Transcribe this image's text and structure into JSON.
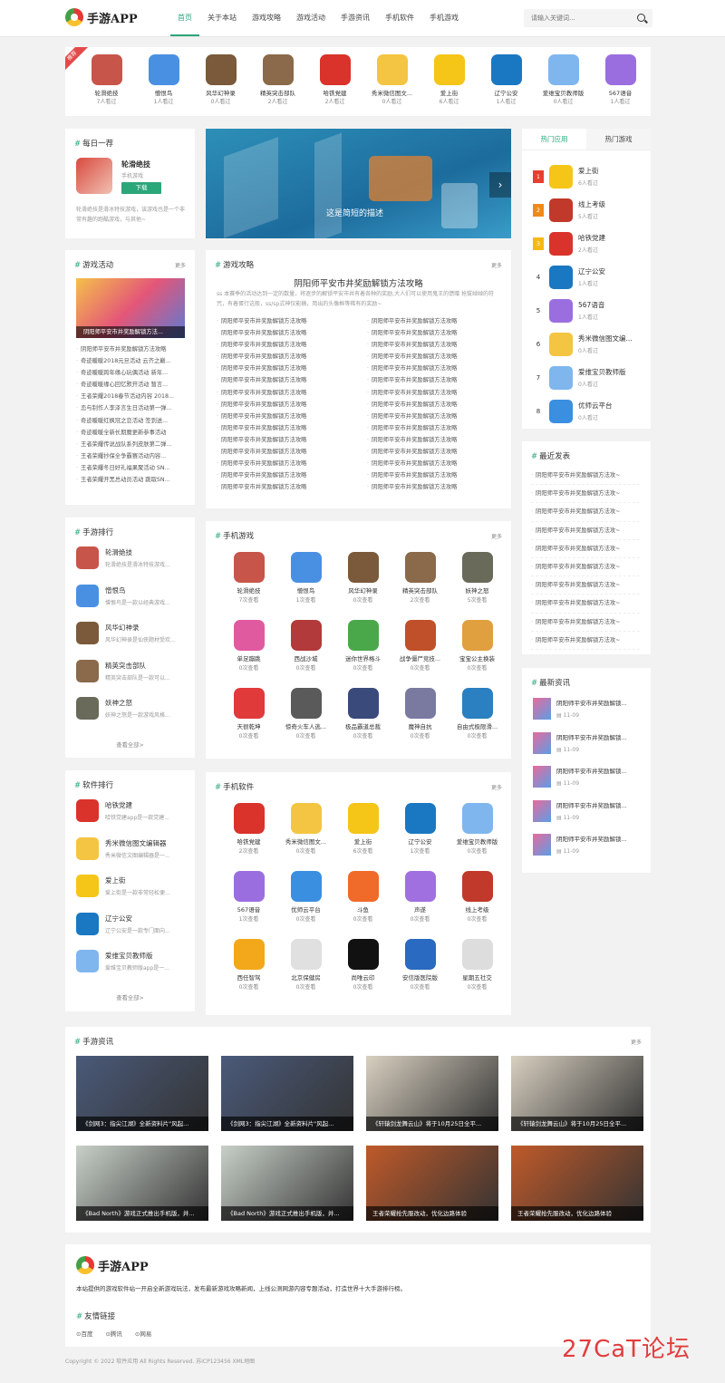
{
  "header": {
    "logo_text": "手游APP",
    "nav": [
      "首页",
      "关于本站",
      "游戏攻略",
      "游戏活动",
      "手游资讯",
      "手机软件",
      "手机游戏"
    ],
    "search_placeholder": "请输入关键词..."
  },
  "top_strip": {
    "hot_tag": "推荐",
    "items": [
      {
        "name": "轮滑绝技",
        "meta": "7人看过",
        "color": "#c8554a"
      },
      {
        "name": "憎恨鸟",
        "meta": "1人看过",
        "color": "#4a90e2"
      },
      {
        "name": "风华幻神录",
        "meta": "0人看过",
        "color": "#7a5a3a"
      },
      {
        "name": "精英突击部队",
        "meta": "2人看过",
        "color": "#8a6a4a"
      },
      {
        "name": "哈铁党建",
        "meta": "2人看过",
        "color": "#d9332b"
      },
      {
        "name": "秀米微信图文...",
        "meta": "0人看过",
        "color": "#f4c542"
      },
      {
        "name": "爱上街",
        "meta": "6人看过",
        "color": "#f5c518"
      },
      {
        "name": "辽宁公安",
        "meta": "1人看过",
        "color": "#1a78c2"
      },
      {
        "name": "爱维宝贝教师版",
        "meta": "0人看过",
        "color": "#7fb6ee"
      },
      {
        "name": "567语音",
        "meta": "1人看过",
        "color": "#9b6ee0"
      }
    ]
  },
  "daily": {
    "title": "每日一荐",
    "app_name": "轮滑绝技",
    "app_type": "手机游戏",
    "download": "下载",
    "desc": "轮滑绝技是滑冰特技游戏，该游戏也是一个非常有趣的跑酷游戏，与其他~"
  },
  "banner": {
    "caption": "这是简短的描述"
  },
  "rank_tabs": {
    "tab1": "热门应用",
    "tab2": "热门游戏"
  },
  "rank_list": [
    {
      "no": "1",
      "name": "爱上街",
      "meta": "6人看过",
      "color": "#f5c518"
    },
    {
      "no": "2",
      "name": "线上考级",
      "meta": "5人看过",
      "color": "#c0392b"
    },
    {
      "no": "3",
      "name": "哈铁党建",
      "meta": "2人看过",
      "color": "#d9332b"
    },
    {
      "no": "4",
      "name": "辽宁公安",
      "meta": "1人看过",
      "color": "#1a78c2"
    },
    {
      "no": "5",
      "name": "567语音",
      "meta": "1人看过",
      "color": "#9b6ee0"
    },
    {
      "no": "6",
      "name": "秀米微信图文编...",
      "meta": "0人看过",
      "color": "#f4c542"
    },
    {
      "no": "7",
      "name": "爱维宝贝教师版",
      "meta": "0人看过",
      "color": "#7fb6ee"
    },
    {
      "no": "8",
      "name": "优师云平台",
      "meta": "0人看过",
      "color": "#3a8fe0"
    }
  ],
  "activities": {
    "title": "游戏活动",
    "more": "更多",
    "img_caption": "阴阳师平安市井奖励解锁方法...",
    "items": [
      "阴阳师平安市井奖励解锁方法攻略",
      "奇迹暖暖2018元旦活动 云齐之巅...",
      "奇迹暖暖跨年缘心玩偶活动 新年...",
      "奇迹暖暖缘心回忆默开活动 暂言...",
      "王者荣耀2018春节活动内容 2018...",
      "恋与制作人李泽言生日活动第一弹...",
      "奇迹暖暖红枫冠之恋活动 签到送...",
      "奇迹暖暖全新长期魔更新参事活动",
      "王者荣耀传说战队系列皮肤第二弹...",
      "王者荣耀抄保全争霸赛活动内容...",
      "王者荣耀冬日好礼福果聚活动 SN...",
      "王者荣耀开黑总动员活动 跳取SN..."
    ]
  },
  "guide": {
    "title": "游戏攻略",
    "more": "更多",
    "headline": "阴阳师平安市井奖励解锁方法攻略",
    "summary": "ss 本赛季的活动达到一定的数量，将逐步的解锁平安市井有着各种的奖励,大人们可以使用鬼王的馈赠 抢拔绰绰的符咒，有着蛋行这般，ss/sp式神仅能稿，用出的头像框等稀有的奖励~",
    "left": [
      "阴阳师平安市井奖励解锁方法攻略",
      "阴阳师平安市井奖励解锁方法攻略",
      "阴阳师平安市井奖励解锁方法攻略",
      "阴阳师平安市井奖励解锁方法攻略",
      "阴阳师平安市井奖励解锁方法攻略",
      "阴阳师平安市井奖励解锁方法攻略",
      "阴阳师平安市井奖励解锁方法攻略",
      "阴阳师平安市井奖励解锁方法攻略",
      "阴阳师平安市井奖励解锁方法攻略",
      "阴阳师平安市井奖励解锁方法攻略",
      "阴阳师平安市井奖励解锁方法攻略",
      "阴阳师平安市井奖励解锁方法攻略",
      "阴阳师平安市井奖励解锁方法攻略",
      "阴阳师平安市井奖励解锁方法攻略",
      "阴阳师平安市井奖励解锁方法攻略"
    ],
    "right": [
      "阴阳师平安市井奖励解锁方法攻略",
      "阴阳师平安市井奖励解锁方法攻略",
      "阴阳师平安市井奖励解锁方法攻略",
      "阴阳师平安市井奖励解锁方法攻略",
      "阴阳师平安市井奖励解锁方法攻略",
      "阴阳师平安市井奖励解锁方法攻略",
      "阴阳师平安市井奖励解锁方法攻略",
      "阴阳师平安市井奖励解锁方法攻略",
      "阴阳师平安市井奖励解锁方法攻略",
      "阴阳师平安市井奖励解锁方法攻略",
      "阴阳师平安市井奖励解锁方法攻略",
      "阴阳师平安市井奖励解锁方法攻略",
      "阴阳师平安市井奖励解锁方法攻略",
      "阴阳师平安市井奖励解锁方法攻略",
      "阴阳师平安市井奖励解锁方法攻略"
    ]
  },
  "recent": {
    "title": "最近发表",
    "items": [
      "阴阳师平安市井奖励解锁方法攻~",
      "阴阳师平安市井奖励解锁方法攻~",
      "阴阳师平安市井奖励解锁方法攻~",
      "阴阳师平安市井奖励解锁方法攻~",
      "阴阳师平安市井奖励解锁方法攻~",
      "阴阳师平安市井奖励解锁方法攻~",
      "阴阳师平安市井奖励解锁方法攻~",
      "阴阳师平安市井奖励解锁方法攻~",
      "阴阳师平安市井奖励解锁方法攻~",
      "阴阳师平安市井奖励解锁方法攻~"
    ]
  },
  "news": {
    "title": "最新资讯",
    "items": [
      {
        "title": "阴阳师平安市井奖励解锁...",
        "date": "11-09"
      },
      {
        "title": "阴阳师平安市井奖励解锁...",
        "date": "11-09"
      },
      {
        "title": "阴阳师平安市井奖励解锁...",
        "date": "11-09"
      },
      {
        "title": "阴阳师平安市井奖励解锁...",
        "date": "11-09"
      },
      {
        "title": "阴阳师平安市井奖励解锁...",
        "date": "11-09"
      }
    ]
  },
  "game_rank": {
    "title": "手游排行",
    "view_all": "查看全部>",
    "items": [
      {
        "name": "轮滑绝技",
        "desc": "轮滑绝技是滑冰特技游戏...",
        "color": "#c8554a"
      },
      {
        "name": "憎恨鸟",
        "desc": "憎恨鸟是一款以经典游戏...",
        "color": "#4a90e2"
      },
      {
        "name": "风华幻神录",
        "desc": "风华幻神录是仙侠题材受欢...",
        "color": "#7a5a3a"
      },
      {
        "name": "精英突击部队",
        "desc": "精英突击部队是一款可以...",
        "color": "#8a6a4a"
      },
      {
        "name": "妖神之怒",
        "desc": "妖神之怒是一款游戏风格...",
        "color": "#6a6a5a"
      }
    ]
  },
  "soft_rank": {
    "title": "软件排行",
    "view_all": "查看全部>",
    "items": [
      {
        "name": "哈铁党建",
        "desc": "哈铁党建app是一款党建...",
        "color": "#d9332b"
      },
      {
        "name": "秀米微信图文编辑器",
        "desc": "秀米微信文图编辑器是一...",
        "color": "#f4c542"
      },
      {
        "name": "爱上街",
        "desc": "爱上街是一款非常轻松便...",
        "color": "#f5c518"
      },
      {
        "name": "辽宁公安",
        "desc": "辽宁公安是一款专门面向...",
        "color": "#1a78c2"
      },
      {
        "name": "爱维宝贝教师版",
        "desc": "爱维宝贝教师版app是一...",
        "color": "#7fb6ee"
      }
    ]
  },
  "mobile_games": {
    "title": "手机游戏",
    "more": "更多",
    "items": [
      {
        "name": "轮滑绝技",
        "meta": "7次查看",
        "color": "#c8554a"
      },
      {
        "name": "憎恨鸟",
        "meta": "1次查看",
        "color": "#4a90e2"
      },
      {
        "name": "风华幻神录",
        "meta": "0次查看",
        "color": "#7a5a3a"
      },
      {
        "name": "精英突击部队",
        "meta": "2次查看",
        "color": "#8a6a4a"
      },
      {
        "name": "妖神之怒",
        "meta": "5次查看",
        "color": "#6a6a5a"
      },
      {
        "name": "单足蹦跳",
        "meta": "0次查看",
        "color": "#e05aa0"
      },
      {
        "name": "西战沙城",
        "meta": "0次查看",
        "color": "#b33a3a"
      },
      {
        "name": "迷你世界格斗",
        "meta": "0次查看",
        "color": "#4aa84a"
      },
      {
        "name": "战争僵尸竞技...",
        "meta": "0次查看",
        "color": "#c0502a"
      },
      {
        "name": "宝宝公主换装",
        "meta": "0次查看",
        "color": "#e0a040"
      },
      {
        "name": "天很乾坤",
        "meta": "0次查看",
        "color": "#e03a3a"
      },
      {
        "name": "惊奇火车人逃...",
        "meta": "0次查看",
        "color": "#5a5a5a"
      },
      {
        "name": "极品霸道总裁",
        "meta": "0次查看",
        "color": "#3a4a7a"
      },
      {
        "name": "魔神自抗",
        "meta": "0次查看",
        "color": "#7a7aa0"
      },
      {
        "name": "自由式极限滑...",
        "meta": "0次查看",
        "color": "#2a80c0"
      }
    ]
  },
  "mobile_soft": {
    "title": "手机软件",
    "more": "更多",
    "items": [
      {
        "name": "哈铁党建",
        "meta": "2次查看",
        "color": "#d9332b"
      },
      {
        "name": "秀米微信图文...",
        "meta": "0次查看",
        "color": "#f4c542"
      },
      {
        "name": "爱上街",
        "meta": "6次查看",
        "color": "#f5c518"
      },
      {
        "name": "辽宁公安",
        "meta": "1次查看",
        "color": "#1a78c2"
      },
      {
        "name": "爱维宝贝教师版",
        "meta": "0次查看",
        "color": "#7fb6ee"
      },
      {
        "name": "567语音",
        "meta": "1次查看",
        "color": "#9b6ee0"
      },
      {
        "name": "优师云平台",
        "meta": "0次查看",
        "color": "#3a8fe0"
      },
      {
        "name": "斗鱼",
        "meta": "0次查看",
        "color": "#f06a2a"
      },
      {
        "name": "声遂",
        "meta": "0次查看",
        "color": "#a070e0"
      },
      {
        "name": "线上考级",
        "meta": "0次查看",
        "color": "#c0392b"
      },
      {
        "name": "西任智驾",
        "meta": "0次查看",
        "color": "#f2a81a"
      },
      {
        "name": "北京保健房",
        "meta": "0次查看",
        "color": "#e0e0e0"
      },
      {
        "name": "尚唯云印",
        "meta": "0次查看",
        "color": "#111111"
      },
      {
        "name": "安信版医院版",
        "meta": "0次查看",
        "color": "#2a6ac0"
      },
      {
        "name": "星期五社交",
        "meta": "0次查看",
        "color": "#dddddd"
      }
    ]
  },
  "game_news": {
    "title": "手游资讯",
    "more": "更多",
    "items": [
      {
        "caption": "《剑网3：指尖江湖》全新资料片\"风起...",
        "color": "#4a5a7a"
      },
      {
        "caption": "《剑网3：指尖江湖》全新资料片\"风起...",
        "color": "#4a5a7a"
      },
      {
        "caption": "《轩辕剑龙舞云山》将于10月25日全平...",
        "color": "#d8d0c0"
      },
      {
        "caption": "《轩辕剑龙舞云山》将于10月25日全平...",
        "color": "#d8d0c0"
      },
      {
        "caption": "《Bad North》游戏正式推出手机版，并...",
        "color": "#c8d0c8"
      },
      {
        "caption": "《Bad North》游戏正式推出手机版，并...",
        "color": "#c8d0c8"
      },
      {
        "caption": "王者荣耀抢先服改动，优化边路体验",
        "color": "#c05a2a"
      },
      {
        "caption": "王者荣耀抢先服改动，优化边路体验",
        "color": "#c05a2a"
      }
    ]
  },
  "footer": {
    "logo_text": "手游APP",
    "desc": "本站提供的游戏软件站一开启全新游戏玩法，发布最新游戏攻略新闻，上线公测网游内容专题活动，打造世界十大手游排行榜。",
    "links_title": "友情链接",
    "links": [
      "百度",
      "腾讯",
      "网易"
    ],
    "copyright": "Copyright © 2022 软件应用 All Rights Reserved. 苏ICP123456 XML地图"
  },
  "watermark": "27CaT论坛"
}
